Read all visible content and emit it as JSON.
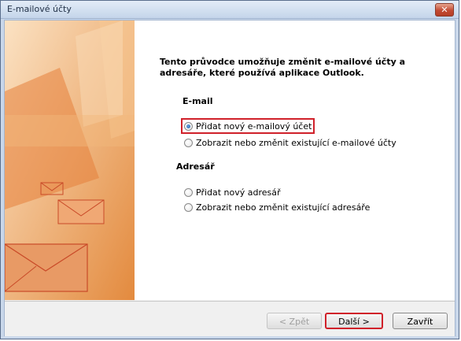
{
  "window": {
    "title": "E-mailové účty",
    "close_glyph": "✕"
  },
  "main": {
    "intro": "Tento průvodce umožňuje změnit e-mailové účty a adresáře, které používá aplikace Outlook.",
    "email_heading": "E-mail",
    "email_options": [
      {
        "label": "Přidat nový e-mailový účet",
        "selected": true
      },
      {
        "label": "Zobrazit nebo změnit existující e-mailové účty",
        "selected": false
      }
    ],
    "address_heading": "Adresář",
    "address_options": [
      {
        "label": "Přidat nový adresář",
        "selected": false
      },
      {
        "label": "Zobrazit nebo změnit existující adresáře",
        "selected": false
      }
    ]
  },
  "buttons": {
    "back": "< Zpět",
    "next": "Další >",
    "close": "Zavřít"
  },
  "colors": {
    "highlight": "#d0212a",
    "banner_orange": "#de7a2e"
  },
  "icons": {
    "close": "close-icon",
    "envelopes": "envelope-icon"
  }
}
